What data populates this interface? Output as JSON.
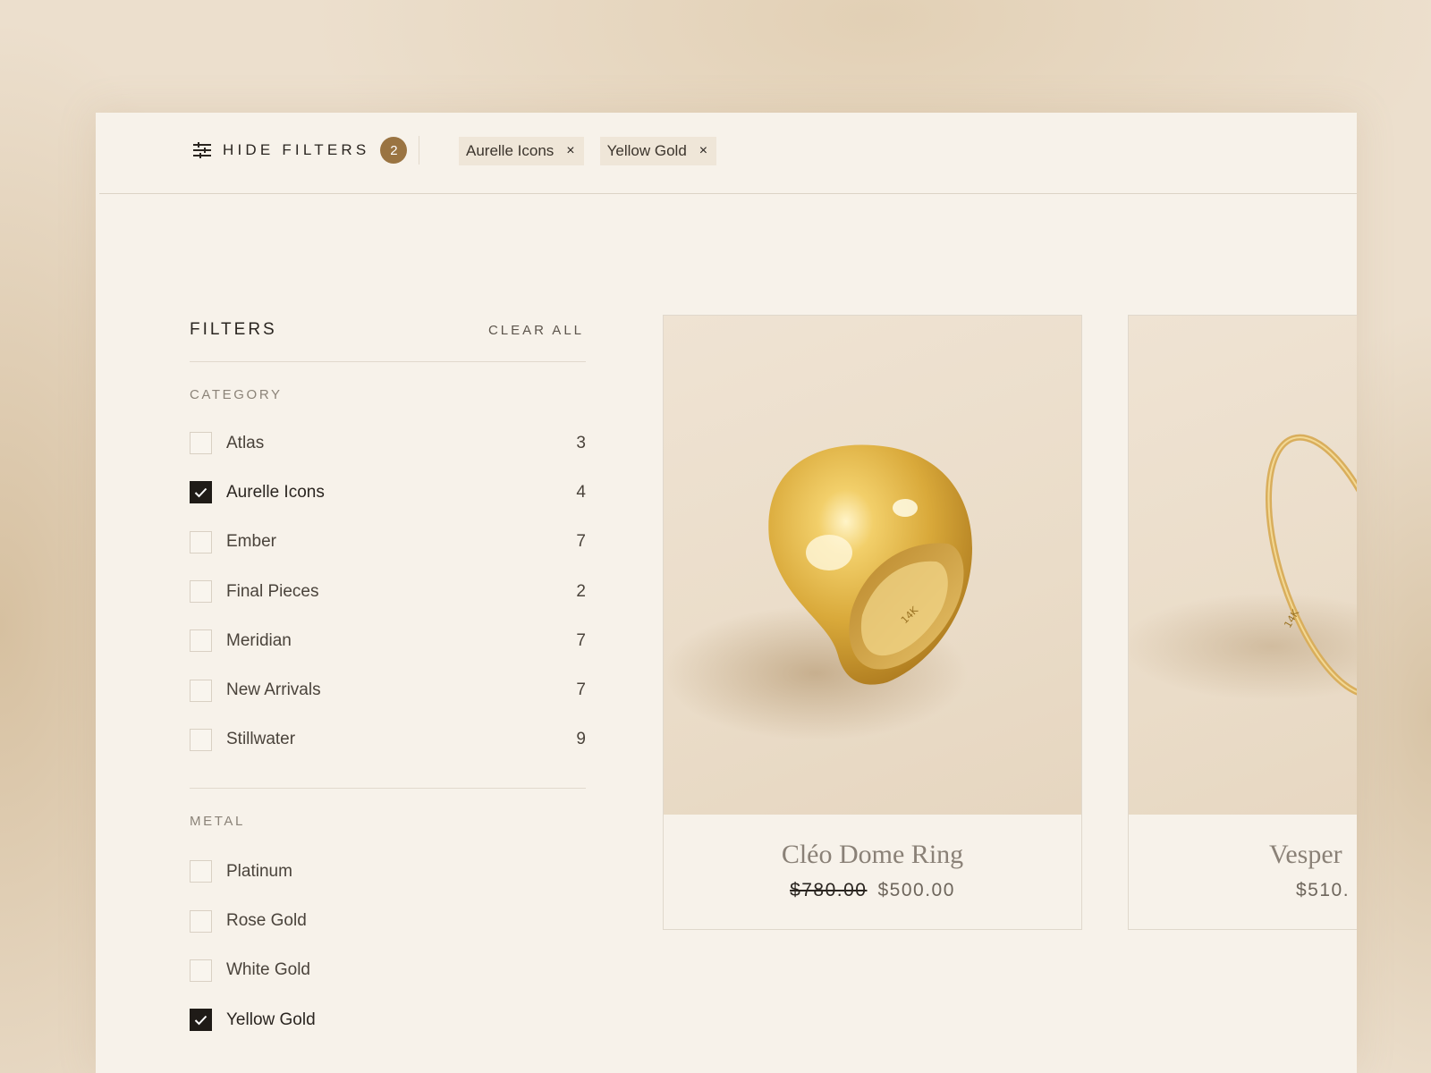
{
  "topbar": {
    "toggle_label": "HIDE FILTERS",
    "active_count": "2",
    "chips": [
      {
        "label": "Aurelle Icons",
        "remove": "×"
      },
      {
        "label": "Yellow Gold",
        "remove": "×"
      }
    ]
  },
  "filters": {
    "title": "FILTERS",
    "clear_all": "CLEAR ALL",
    "category": {
      "label": "CATEGORY",
      "options": [
        {
          "label": "Atlas",
          "count": "3",
          "checked": false
        },
        {
          "label": "Aurelle Icons",
          "count": "4",
          "checked": true
        },
        {
          "label": "Ember",
          "count": "7",
          "checked": false
        },
        {
          "label": "Final Pieces",
          "count": "2",
          "checked": false
        },
        {
          "label": "Meridian",
          "count": "7",
          "checked": false
        },
        {
          "label": "New Arrivals",
          "count": "7",
          "checked": false
        },
        {
          "label": "Stillwater",
          "count": "9",
          "checked": false
        }
      ]
    },
    "metal": {
      "label": "METAL",
      "options": [
        {
          "label": "Platinum",
          "checked": false
        },
        {
          "label": "Rose Gold",
          "checked": false
        },
        {
          "label": "White Gold",
          "checked": false
        },
        {
          "label": "Yellow Gold",
          "checked": true
        }
      ]
    }
  },
  "products": [
    {
      "name": "Cléo Dome Ring",
      "original_price": "$780.00",
      "price": "$500.00",
      "engraving": "14K"
    },
    {
      "name": "Vesper",
      "price": "$510.",
      "engraving": "14K"
    }
  ],
  "colors": {
    "accent": "#9a7442",
    "page_bg": "#f7f2ea",
    "text": "#2a2520",
    "checkbox_checked": "#1f1b17"
  },
  "icons": {
    "filter_toggle": "sliders-icon",
    "chip_remove": "close-icon",
    "checkbox_checked": "check-icon"
  }
}
